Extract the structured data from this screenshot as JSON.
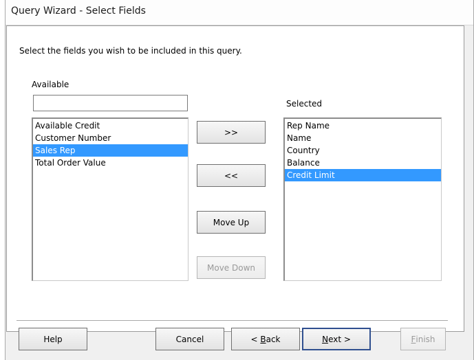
{
  "window": {
    "title": "Query Wizard - Select Fields"
  },
  "instruction": "Select the fields you wish to be included in this query.",
  "available": {
    "label": "Available",
    "filter_value": "",
    "items": [
      "Available Credit",
      "Customer Number",
      "Sales Rep",
      "Total Order Value"
    ],
    "selected_item": "Sales Rep"
  },
  "selected": {
    "label": "Selected",
    "items": [
      "Rep Name",
      "Name",
      "Country",
      "Balance",
      "Credit Limit"
    ],
    "selected_item": "Credit Limit"
  },
  "buttons": {
    "add": ">>",
    "remove": "<<",
    "move_up": "Move Up",
    "move_down": "Move Down",
    "help": "Help",
    "cancel": "Cancel",
    "back_prefix": "< ",
    "back_mnemonic": "B",
    "back_rest": "ack",
    "next_mnemonic": "N",
    "next_rest": "ext >",
    "finish_mnemonic": "F",
    "finish_rest": "inish"
  },
  "state": {
    "move_down_enabled": false,
    "finish_enabled": false,
    "default_button": "next"
  },
  "colors": {
    "selection": "#3399ff",
    "selection_text": "#ffffff",
    "disabled_text": "#9a9a9a"
  }
}
